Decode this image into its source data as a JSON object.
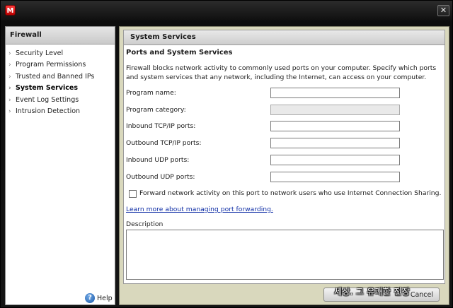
{
  "window": {
    "logo_letter": "M",
    "close_glyph": "✕"
  },
  "sidebar": {
    "title": "Firewall",
    "items": [
      {
        "label": "Security Level",
        "active": false
      },
      {
        "label": "Program Permissions",
        "active": false
      },
      {
        "label": "Trusted and Banned IPs",
        "active": false
      },
      {
        "label": "System Services",
        "active": true
      },
      {
        "label": "Event Log Settings",
        "active": false
      },
      {
        "label": "Intrusion Detection",
        "active": false
      }
    ],
    "help_label": "Help",
    "help_glyph": "?"
  },
  "main": {
    "header": "System Services",
    "section_title": "Ports and System Services",
    "description": "Firewall blocks network activity to commonly used ports on your computer. Specify which ports and system services that any network, including the Internet, can access on your computer.",
    "fields": {
      "program_name": {
        "label": "Program name:",
        "value": ""
      },
      "program_category": {
        "label": "Program category:",
        "value": ""
      },
      "inbound_tcp": {
        "label": "Inbound TCP/IP ports:",
        "value": ""
      },
      "outbound_tcp": {
        "label": "Outbound TCP/IP ports:",
        "value": ""
      },
      "inbound_udp": {
        "label": "Inbound UDP ports:",
        "value": ""
      },
      "outbound_udp": {
        "label": "Outbound UDP ports:",
        "value": ""
      }
    },
    "forward_checkbox_label": "Forward network activity on this port to network users who use Internet Connection Sharing.",
    "learn_more_link": "Learn more about managing port forwarding.",
    "description_label": "Description"
  },
  "footer": {
    "cancel_label": "Cancel",
    "watermark": "세상. 그 유쾌한 전장"
  },
  "icons": {
    "logo": "app-logo-icon",
    "close": "close-icon",
    "help": "help-icon",
    "chevron": "chevron-right-icon"
  }
}
